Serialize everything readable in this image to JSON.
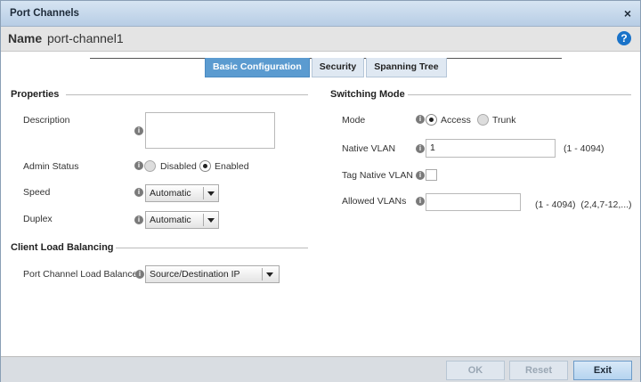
{
  "window": {
    "title": "Port Channels",
    "close_glyph": "×"
  },
  "name_bar": {
    "label": "Name",
    "value": "port-channel1",
    "help_glyph": "?"
  },
  "tabs": [
    {
      "label": "Basic Configuration",
      "active": true
    },
    {
      "label": "Security",
      "active": false
    },
    {
      "label": "Spanning Tree",
      "active": false
    }
  ],
  "properties": {
    "heading": "Properties",
    "description": {
      "label": "Description",
      "value": ""
    },
    "admin_status": {
      "label": "Admin Status",
      "options": [
        "Disabled",
        "Enabled"
      ],
      "selected": "Enabled"
    },
    "speed": {
      "label": "Speed",
      "value": "Automatic"
    },
    "duplex": {
      "label": "Duplex",
      "value": "Automatic"
    }
  },
  "client_load_balancing": {
    "heading": "Client Load Balancing",
    "load_balance": {
      "label": "Port Channel Load Balance",
      "value": "Source/Destination IP"
    }
  },
  "switching_mode": {
    "heading": "Switching Mode",
    "mode": {
      "label": "Mode",
      "options": [
        "Access",
        "Trunk"
      ],
      "selected": "Access"
    },
    "native_vlan": {
      "label": "Native VLAN",
      "value": "1",
      "range": "(1 - 4094)"
    },
    "tag_native_vlan": {
      "label": "Tag Native VLAN",
      "checked": false
    },
    "allowed_vlans": {
      "label": "Allowed VLANs",
      "value": "",
      "range": "(1 - 4094)  (2,4,7-12,...)"
    }
  },
  "info_glyph": "i",
  "footer": {
    "ok": "OK",
    "reset": "Reset",
    "exit": "Exit"
  },
  "colors": {
    "titlebar": "#c4d7eb",
    "active_tab": "#5b9bd0",
    "help": "#1a73c9"
  },
  "icons": {
    "close": "close-icon",
    "help": "help-icon",
    "info": "info-icon",
    "dropdown": "chevron-down-icon"
  }
}
